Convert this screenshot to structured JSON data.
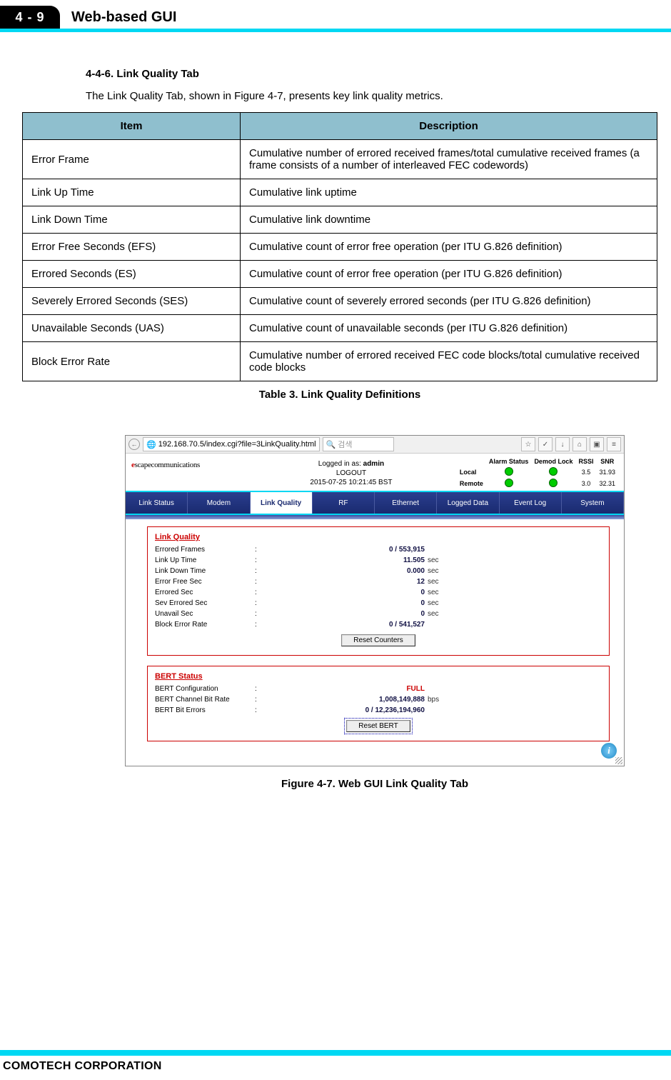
{
  "header": {
    "page_num": "4 - 9",
    "chapter": "Web-based GUI"
  },
  "section": {
    "heading": "4-4-6. Link Quality Tab",
    "intro": "The Link Quality Tab, shown in Figure 4-7, presents key link quality metrics."
  },
  "def_table": {
    "cols": {
      "item": "Item",
      "desc": "Description"
    },
    "rows": [
      {
        "item": "Error Frame",
        "desc": "Cumulative number of errored received frames/total cumulative received frames (a frame consists of a number of interleaved FEC codewords)"
      },
      {
        "item": "Link Up Time",
        "desc": "Cumulative link uptime"
      },
      {
        "item": "Link Down Time",
        "desc": "Cumulative link downtime"
      },
      {
        "item": "Error Free Seconds (EFS)",
        "desc": "Cumulative count of error free operation (per ITU G.826 definition)"
      },
      {
        "item": "Errored Seconds (ES)",
        "desc": "Cumulative count of error free operation (per ITU G.826 definition)"
      },
      {
        "item": "Severely Errored Seconds (SES)",
        "desc": "Cumulative count of severely errored seconds (per ITU G.826 definition)"
      },
      {
        "item": "Unavailable Seconds (UAS)",
        "desc": "Cumulative count of unavailable seconds (per ITU G.826 definition)"
      },
      {
        "item": "Block Error Rate",
        "desc": "Cumulative number of errored received FEC code blocks/total cumulative received code blocks"
      }
    ],
    "caption": "Table 3. Link Quality Definitions"
  },
  "fig": {
    "browser": {
      "url": "192.168.70.5/index.cgi?file=3LinkQuality.html",
      "search_placeholder": "검색"
    },
    "gui_header": {
      "logo_prefix": "e",
      "logo_rest": "scapecommunications",
      "logged_in_label": "Logged in as:",
      "logged_in_user": "admin",
      "logout": "LOGOUT",
      "timestamp": "2015-07-25 10:21:45 BST",
      "status_cols": [
        "Alarm Status",
        "Demod Lock",
        "RSSI",
        "SNR"
      ],
      "local_label": "Local",
      "remote_label": "Remote",
      "local": {
        "rssi": "3.5",
        "snr": "31.93"
      },
      "remote": {
        "rssi": "3.0",
        "snr": "32.31"
      }
    },
    "nav": [
      "Link Status",
      "Modem",
      "Link Quality",
      "RF",
      "Ethernet",
      "Logged Data",
      "Event Log",
      "System"
    ],
    "link_quality": {
      "title": "Link Quality",
      "rows": [
        {
          "lbl": "Errored Frames",
          "val": "0 / 553,915",
          "unit": ""
        },
        {
          "lbl": "Link Up Time",
          "val": "11.505",
          "unit": "sec"
        },
        {
          "lbl": "Link Down Time",
          "val": "0.000",
          "unit": "sec"
        },
        {
          "lbl": "Error Free Sec",
          "val": "12",
          "unit": "sec"
        },
        {
          "lbl": "Errored Sec",
          "val": "0",
          "unit": "sec"
        },
        {
          "lbl": "Sev Errored Sec",
          "val": "0",
          "unit": "sec"
        },
        {
          "lbl": "Unavail Sec",
          "val": "0",
          "unit": "sec"
        },
        {
          "lbl": "Block Error Rate",
          "val": "0 / 541,527",
          "unit": ""
        }
      ],
      "button": "Reset Counters"
    },
    "bert": {
      "title": "BERT Status",
      "rows": [
        {
          "lbl": "BERT Configuration",
          "val": "FULL",
          "unit": "",
          "red": true
        },
        {
          "lbl": "BERT Channel Bit Rate",
          "val": "1,008,149,888",
          "unit": "bps"
        },
        {
          "lbl": "BERT Bit Errors",
          "val": "0 / 12,236,194,960",
          "unit": ""
        }
      ],
      "button": "Reset BERT"
    },
    "caption": "Figure 4-7. Web GUI Link Quality Tab",
    "info_glyph": "i"
  },
  "footer": {
    "corp": "COMOTECH CORPORATION"
  }
}
